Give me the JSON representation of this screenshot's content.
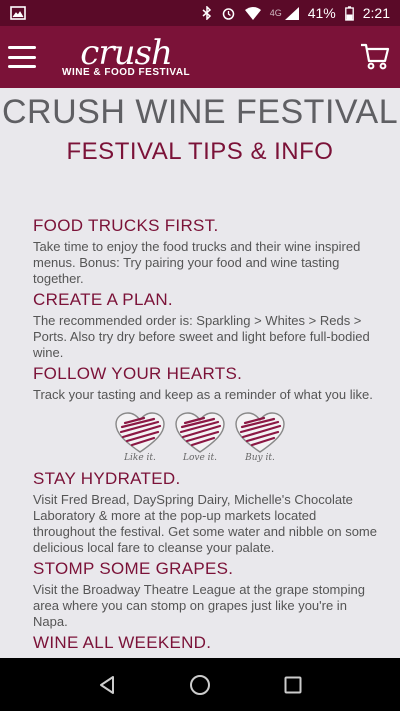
{
  "statusbar": {
    "battery": "41%",
    "time": "2:21",
    "network": "4G"
  },
  "appbar": {
    "logo_script": "crush",
    "logo_sub": "WINE & FOOD FESTIVAL"
  },
  "page": {
    "title": "CRUSH WINE FESTIVAL",
    "subtitle": "FESTIVAL TIPS & INFO"
  },
  "sections": [
    {
      "heading": "FOOD TRUCKS FIRST.",
      "text": "Take time to enjoy the food trucks and their wine inspired menus. Bonus: Try pairing your food and wine tasting together."
    },
    {
      "heading": "CREATE A PLAN.",
      "text": "The recommended order is: Sparkling > Whites > Reds > Ports. Also try dry before sweet and light before full-bodied wine."
    },
    {
      "heading": "FOLLOW YOUR HEARTS.",
      "text": "Track your tasting and keep as a reminder of what you like."
    },
    {
      "heading": "STAY HYDRATED.",
      "text": "Visit Fred Bread, DaySpring Dairy, Michelle's Chocolate Laboratory & more at the pop-up markets located throughout the festival. Get some water and nibble on some delicious local fare to cleanse your palate."
    },
    {
      "heading": "STOMP SOME GRAPES.",
      "text": "Visit the Broadway Theatre League at the grape stomping area where you can stomp on grapes just like you're in Napa."
    },
    {
      "heading": "WINE ALL WEEKEND."
    }
  ],
  "hearts": [
    {
      "label": "Like it."
    },
    {
      "label": "Love it."
    },
    {
      "label": "Buy it."
    }
  ],
  "colors": {
    "brand": "#7b1238",
    "statusbar": "#5a0a28"
  }
}
